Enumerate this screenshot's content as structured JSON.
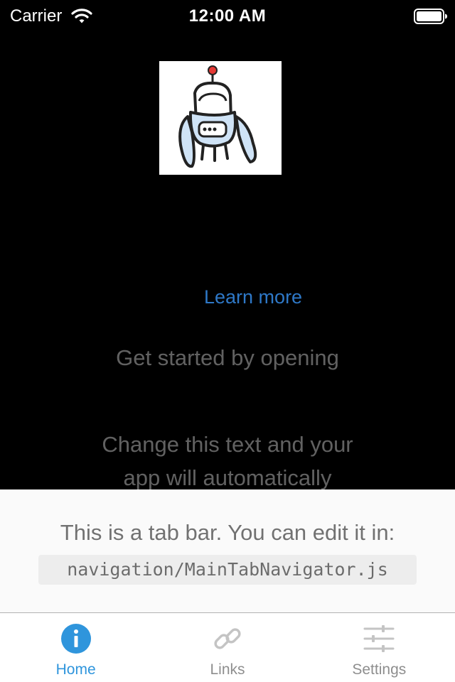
{
  "status_bar": {
    "carrier": "Carrier",
    "time": "12:00 AM"
  },
  "main": {
    "robot_icon": "robot-logo-icon",
    "learn_more": "Learn more",
    "get_started": "Get started by opening",
    "change_text_line1": "Change this text and your",
    "change_text_line2": "app will automatically"
  },
  "tab_bar_info": {
    "text": "This is a tab bar. You can edit it in:",
    "path": "navigation/MainTabNavigator.js"
  },
  "tabs": [
    {
      "label": "Home",
      "icon": "info-icon",
      "active": true
    },
    {
      "label": "Links",
      "icon": "link-icon",
      "active": false
    },
    {
      "label": "Settings",
      "icon": "settings-sliders-icon",
      "active": false
    }
  ],
  "colors": {
    "accent": "#2f95dc",
    "link": "#2e78c7",
    "inactive_tab": "#8e8e8e",
    "background": "#000000",
    "panel": "#fafafa"
  }
}
